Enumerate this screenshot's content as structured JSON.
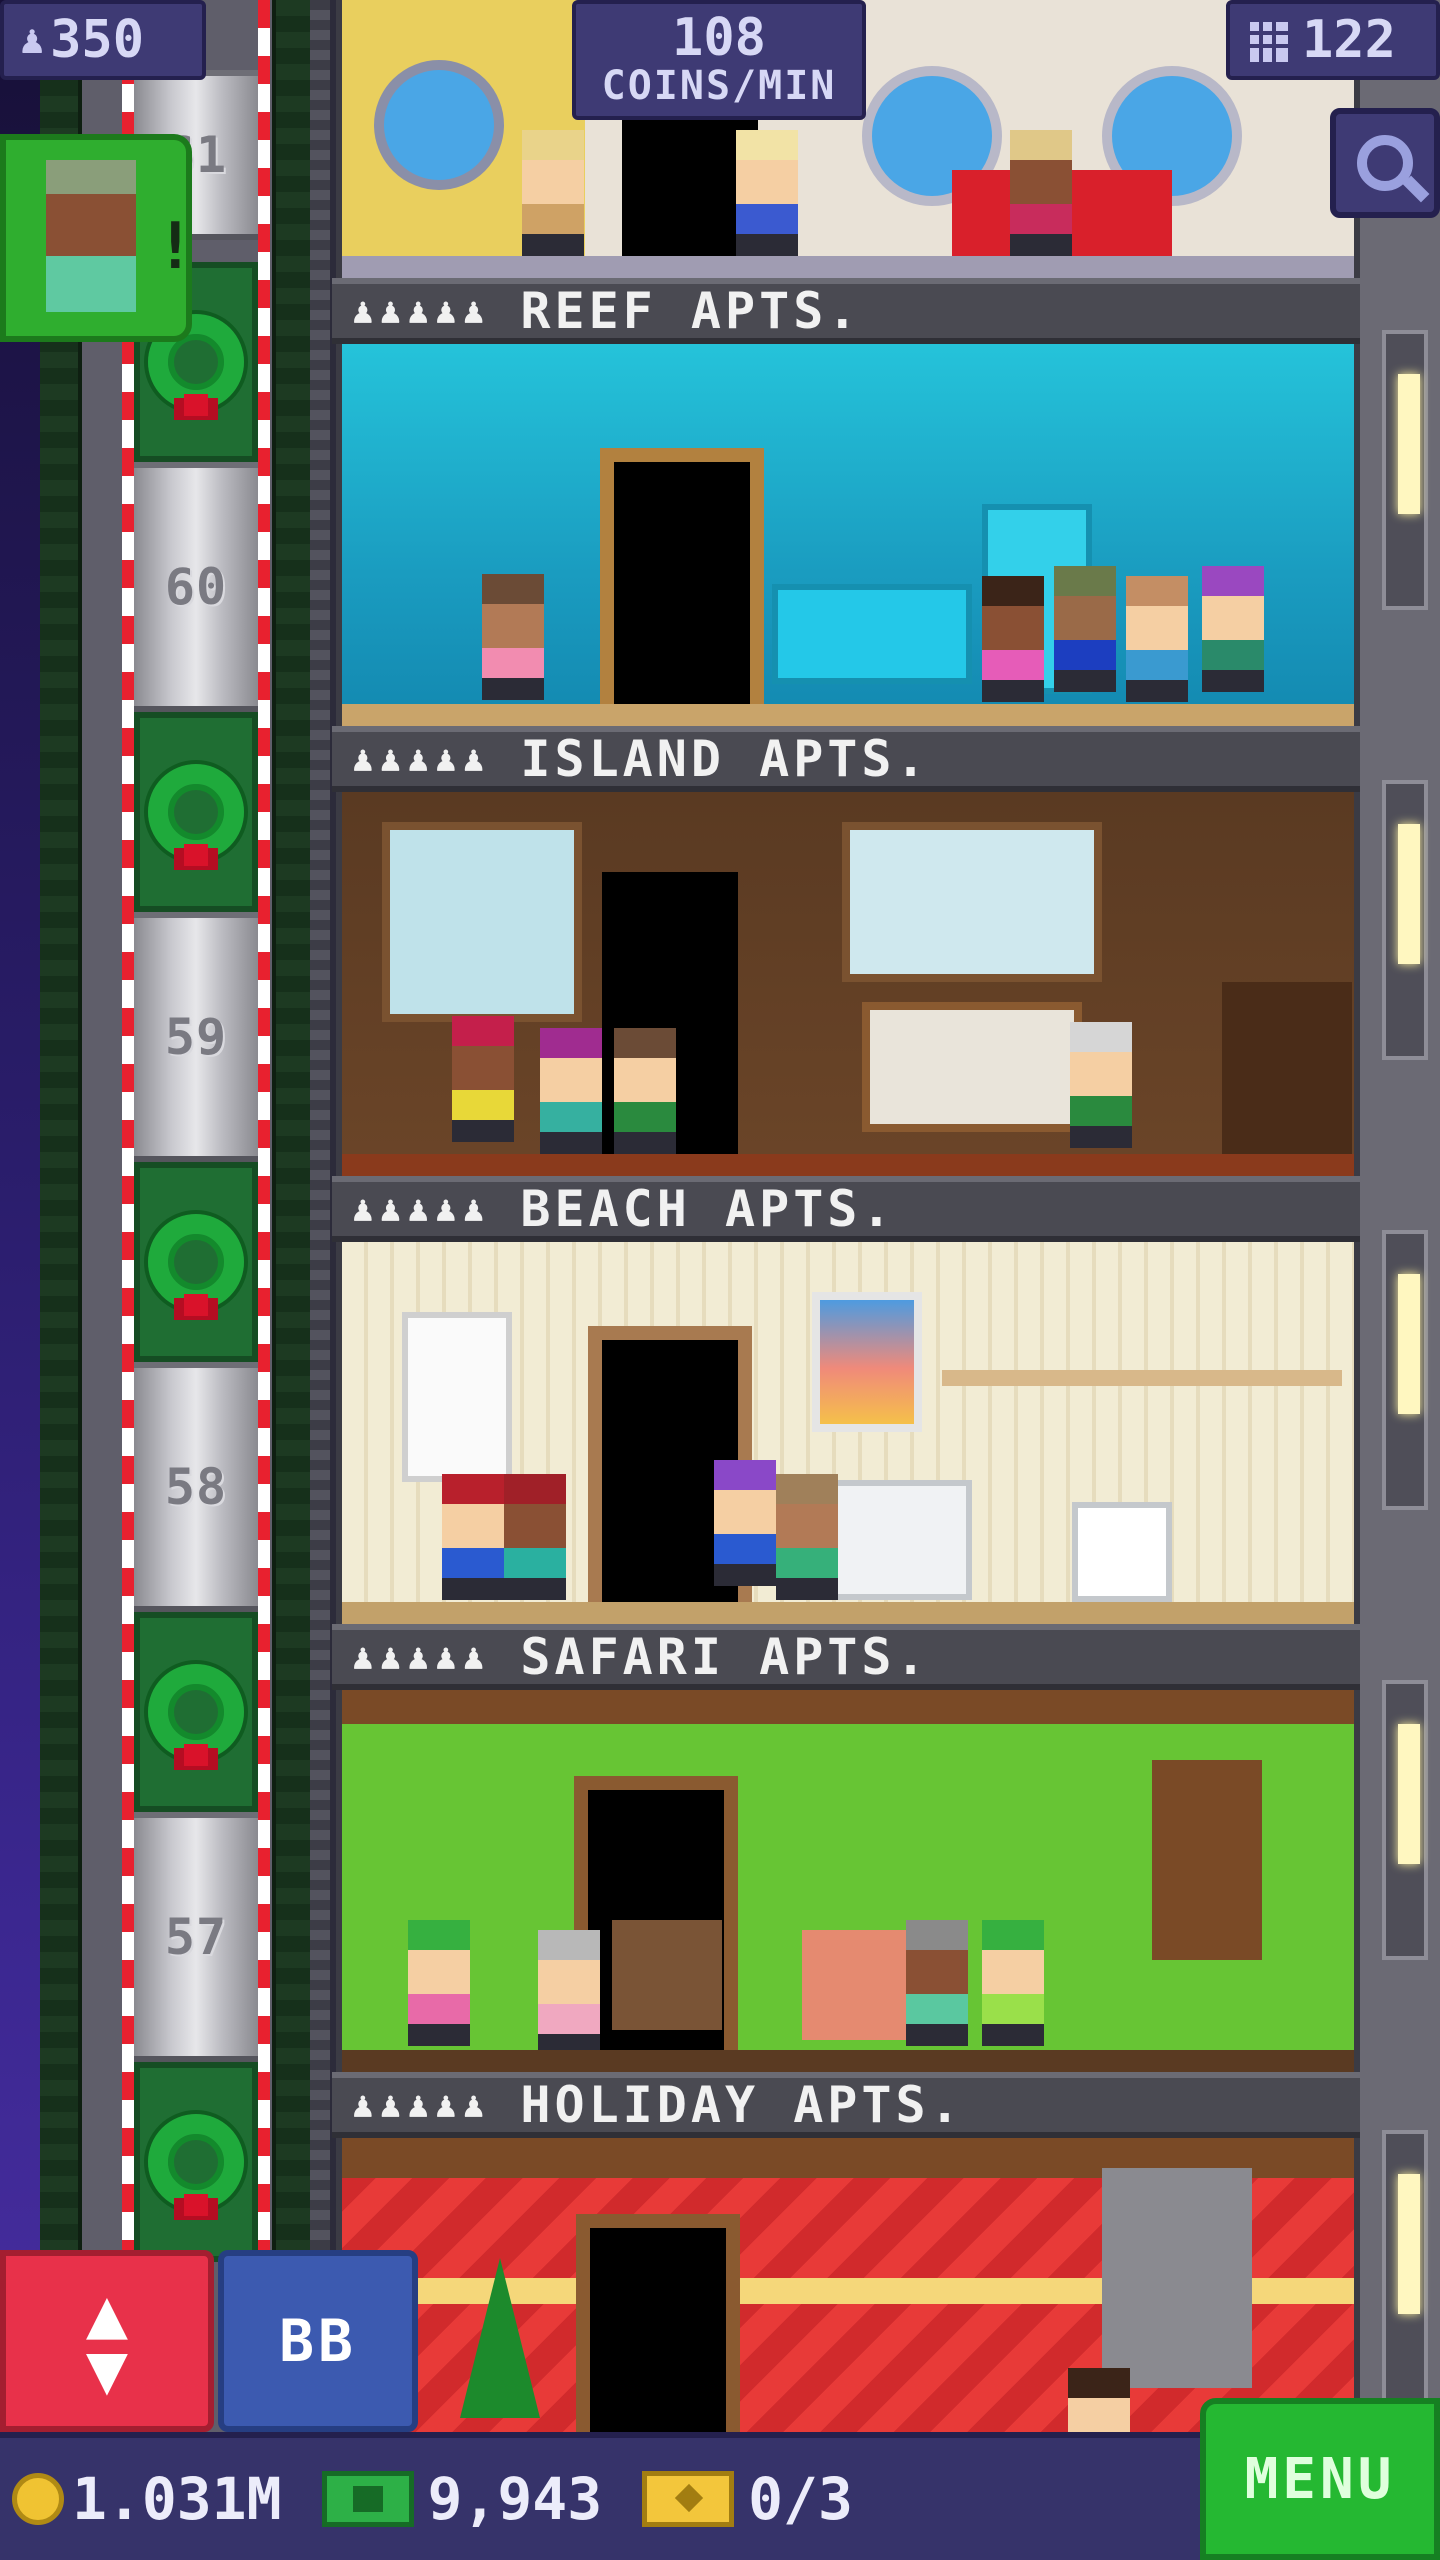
{
  "hud": {
    "population": "350",
    "coins_per_min_value": "108",
    "coins_per_min_label": "COINS/MIN",
    "floor_count": "122"
  },
  "shaft": {
    "floors": [
      "61",
      "60",
      "59",
      "58",
      "57"
    ]
  },
  "floors": [
    {
      "id": "reef",
      "name": "REEF APTS.",
      "residents_icon": "♟♟♟♟♟"
    },
    {
      "id": "island",
      "name": "ISLAND APTS.",
      "residents_icon": "♟♟♟♟♟"
    },
    {
      "id": "beach",
      "name": "BEACH APTS.",
      "residents_icon": "♟♟♟♟♟"
    },
    {
      "id": "safari",
      "name": "SAFARI APTS.",
      "residents_icon": "♟♟♟♟♟"
    },
    {
      "id": "holiday",
      "name": "HOLIDAY APTS.",
      "residents_icon": "♟♟♟♟♟"
    }
  ],
  "controls": {
    "elevator_arrows": "▲\n▼",
    "bb_label": "BB",
    "visitor_alert": "!",
    "menu_label": "MENU"
  },
  "currency": {
    "coins": "1.031M",
    "bux": "9,943",
    "tickets": "0/3"
  },
  "colors": {
    "coin": "#f0c332",
    "bux": "#2db047",
    "menu": "#25b832",
    "elevator_button": "#e8314a",
    "bb_button": "#3c5ab0"
  },
  "icons": [
    "population-icon",
    "floors-icon",
    "search-icon",
    "coin-icon",
    "bux-icon",
    "ticket-icon",
    "up-down-arrows-icon",
    "wreath-icon"
  ]
}
